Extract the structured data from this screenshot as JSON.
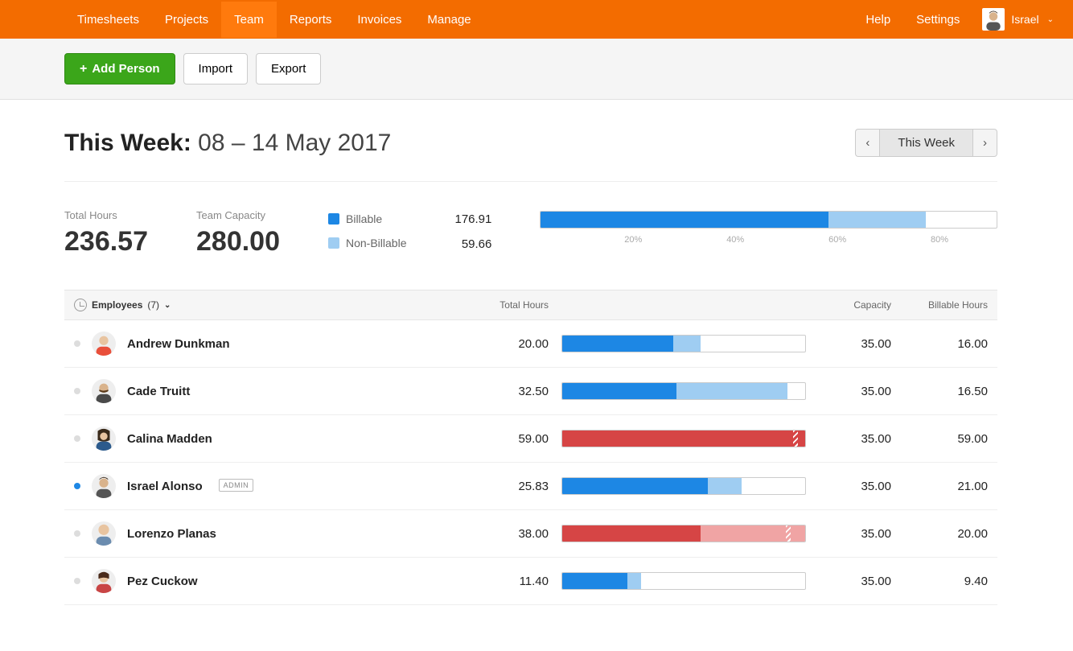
{
  "nav": {
    "items": [
      "Timesheets",
      "Projects",
      "Team",
      "Reports",
      "Invoices",
      "Manage"
    ],
    "active": 2,
    "right": [
      "Help",
      "Settings"
    ],
    "user_name": "Israel"
  },
  "toolbar": {
    "add_label": "Add Person",
    "import_label": "Import",
    "export_label": "Export"
  },
  "header": {
    "title_prefix": "This Week:",
    "date_range": "08 – 14 May 2017",
    "range_button": "This Week"
  },
  "summary": {
    "total_hours_label": "Total Hours",
    "total_hours": "236.57",
    "capacity_label": "Team Capacity",
    "capacity": "280.00",
    "billable_label": "Billable",
    "nonbillable_label": "Non-Billable",
    "billable_value": "176.91",
    "nonbillable_value": "59.66",
    "colors": {
      "billable": "#1d87e4",
      "nonbillable": "#9fcdf2",
      "over_primary": "#d64545",
      "over_light": "#f0a4a4"
    },
    "ticks": [
      "20%",
      "40%",
      "60%",
      "80%"
    ]
  },
  "table": {
    "header": {
      "employees_label": "Employees",
      "employees_count": "(7)",
      "total_hours": "Total Hours",
      "capacity": "Capacity",
      "billable": "Billable Hours"
    },
    "rows": [
      {
        "name": "Andrew Dunkman",
        "total": "20.00",
        "capacity": "35.00",
        "billable": "16.00",
        "status_on": false,
        "admin": false,
        "over": false,
        "bar_billable_pct": 45.7,
        "bar_nonbillable_pct": 11.4
      },
      {
        "name": "Cade Truitt",
        "total": "32.50",
        "capacity": "35.00",
        "billable": "16.50",
        "status_on": false,
        "admin": false,
        "over": false,
        "bar_billable_pct": 47.1,
        "bar_nonbillable_pct": 45.7
      },
      {
        "name": "Calina Madden",
        "total": "59.00",
        "capacity": "35.00",
        "billable": "59.00",
        "status_on": false,
        "admin": false,
        "over": true,
        "bar_billable_pct": 100.0,
        "bar_nonbillable_pct": 0.0,
        "zig_pct": 95
      },
      {
        "name": "Israel Alonso",
        "total": "25.83",
        "capacity": "35.00",
        "billable": "21.00",
        "status_on": true,
        "admin": true,
        "over": false,
        "bar_billable_pct": 60.0,
        "bar_nonbillable_pct": 13.8
      },
      {
        "name": "Lorenzo Planas",
        "total": "38.00",
        "capacity": "35.00",
        "billable": "20.00",
        "status_on": false,
        "admin": false,
        "over": true,
        "bar_billable_pct": 57.1,
        "bar_nonbillable_pct": 42.9,
        "zig_pct": 92
      },
      {
        "name": "Pez Cuckow",
        "total": "11.40",
        "capacity": "35.00",
        "billable": "9.40",
        "status_on": false,
        "admin": false,
        "over": false,
        "bar_billable_pct": 26.9,
        "bar_nonbillable_pct": 5.7
      }
    ]
  },
  "chart_data": {
    "type": "bar",
    "title": "Team hours vs capacity (This Week)",
    "billable_hours": 176.91,
    "nonbillable_hours": 59.66,
    "capacity_hours": 280.0,
    "billable_pct_of_capacity": 63.2,
    "nonbillable_pct_of_capacity": 21.3,
    "ticks_pct": [
      20,
      40,
      60,
      80
    ]
  }
}
